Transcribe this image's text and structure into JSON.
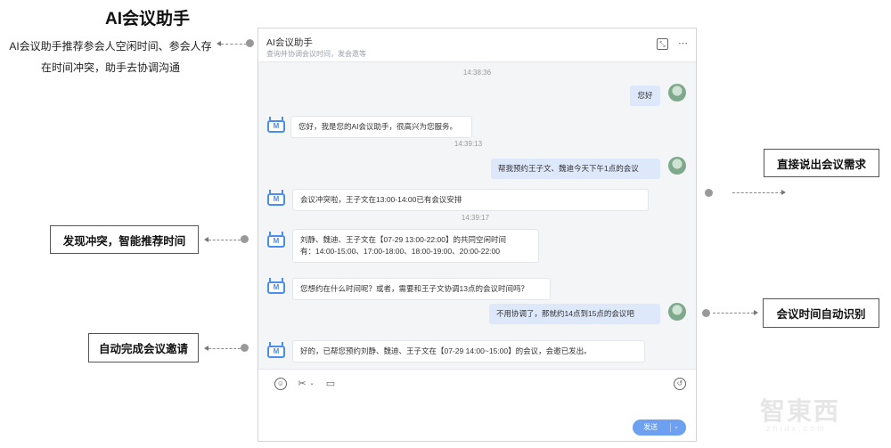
{
  "headline": "AI会议助手",
  "intro": "AI会议助手推荐参会人空闲时间、参会人存在时间冲突，助手去协调沟通",
  "callouts": {
    "conflict": "发现冲突，智能推荐时间",
    "invite": "自动完成会议邀请",
    "direct": "直接说出会议需求",
    "time_detect": "会议时间自动识别"
  },
  "window": {
    "title": "AI会议助手",
    "subtitle": "查询并协调会议时间，发会邀等",
    "icons": [
      "window-toggle-icon",
      "more-icon"
    ]
  },
  "chat": {
    "timestamps": [
      "14:38:36",
      "14:39:13",
      "14:39:17"
    ],
    "messages": [
      {
        "from": "user",
        "text": "您好"
      },
      {
        "from": "bot",
        "text": "您好，我是您的AI会议助手，很高兴为您服务。"
      },
      {
        "from": "user",
        "text": "帮我预约王子文、魏迪今天下午1点的会议"
      },
      {
        "from": "bot",
        "text": "会议冲突啦，王子文在13:00-14:00已有会议安排"
      },
      {
        "from": "bot",
        "line1": "刘静、魏迪、王子文在【07-29 13:00-22:00】的共同空闲时间",
        "line2": "有：14:00-15:00、17:00-18:00、18:00-19:00、20:00-22:00"
      },
      {
        "from": "bot",
        "text": "您想约在什么时间呢？或者，需要和王子文协调13点的会议时间吗？"
      },
      {
        "from": "user",
        "text": "不用协调了，那就约14点到15点的会议吧"
      },
      {
        "from": "bot",
        "text": "好的，已帮您预约刘静、魏迪、王子文在【07-29 14:00~15:00】的会议，会邀已发出。"
      }
    ]
  },
  "composer": {
    "tools": [
      "emoji-icon",
      "scissors-icon",
      "folder-upload-icon",
      "history-icon"
    ],
    "send_label": "发送"
  },
  "colors": {
    "accent": "#4a8df0",
    "user_bubble": "#dde8fb",
    "send": "#6ea0f2"
  }
}
